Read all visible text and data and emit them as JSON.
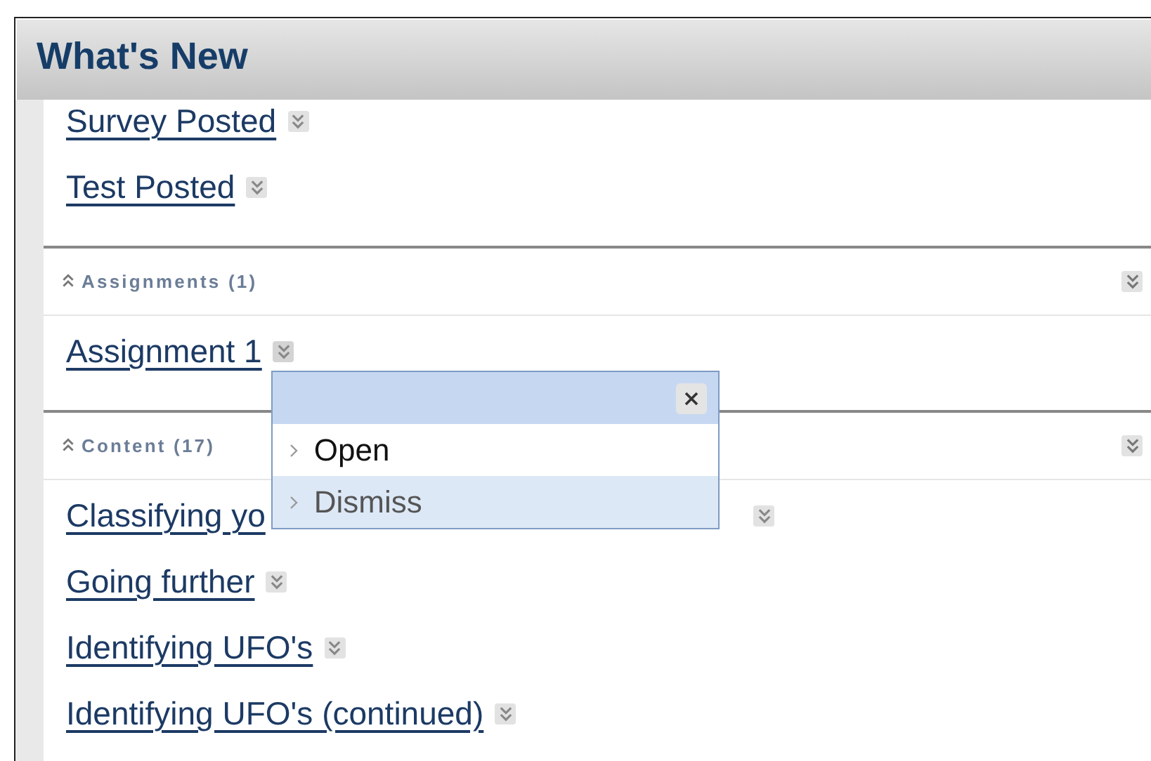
{
  "panel": {
    "title": "What's New"
  },
  "sections": [
    {
      "items": [
        {
          "label": "Survey Posted",
          "menu_open": false
        },
        {
          "label": "Test Posted",
          "menu_open": false
        }
      ]
    },
    {
      "header": "Assignments (1)",
      "expanded": true,
      "items": [
        {
          "label": "Assignment 1",
          "menu_open": true
        }
      ]
    },
    {
      "header": "Content (17)",
      "expanded": true,
      "items": [
        {
          "label": "Classifying yo",
          "menu_open": false
        },
        {
          "label": "Going further",
          "menu_open": false
        },
        {
          "label": "Identifying UFO's",
          "menu_open": false
        },
        {
          "label": "Identifying UFO's (continued)",
          "menu_open": false
        }
      ]
    }
  ],
  "context_menu": {
    "options": [
      {
        "label": "Open",
        "highlighted": false
      },
      {
        "label": "Dismiss",
        "highlighted": true
      }
    ]
  }
}
